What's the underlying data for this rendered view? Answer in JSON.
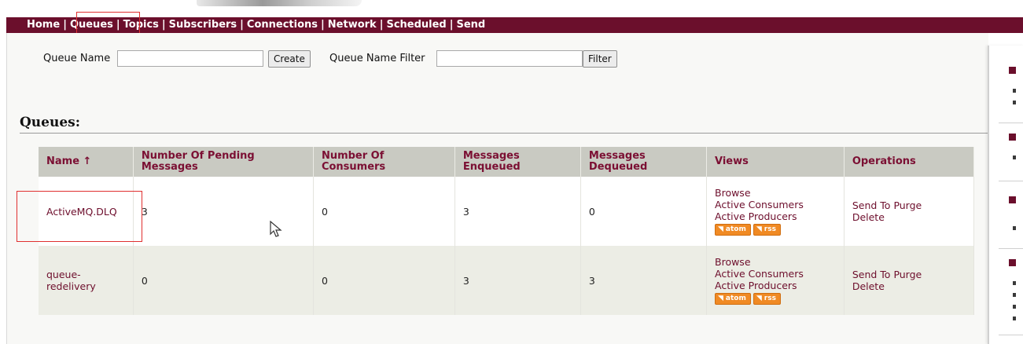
{
  "nav": {
    "items": [
      "Home",
      "Queues",
      "Topics",
      "Subscribers",
      "Connections",
      "Network",
      "Scheduled",
      "Send"
    ],
    "separator": "|"
  },
  "form": {
    "queue_name_label": "Queue Name",
    "queue_name_value": "",
    "create_label": "Create",
    "filter_label": "Queue Name Filter",
    "filter_value": "",
    "filter_button": "Filter"
  },
  "section_title": "Queues:",
  "table": {
    "headers": [
      "Name ↑",
      "Number Of Pending Messages",
      "Number Of Consumers",
      "Messages Enqueued",
      "Messages Dequeued",
      "Views",
      "Operations"
    ],
    "rows": [
      {
        "name": "ActiveMQ.DLQ",
        "pending": "3",
        "consumers": "0",
        "enqueued": "3",
        "dequeued": "0",
        "views": [
          "Browse",
          "Active Consumers",
          "Active Producers"
        ],
        "feeds": [
          "atom",
          "rss"
        ],
        "operations": [
          "Send To",
          "Purge",
          "Delete"
        ]
      },
      {
        "name": "queue-redelivery",
        "pending": "0",
        "consumers": "0",
        "enqueued": "3",
        "dequeued": "3",
        "views": [
          "Browse",
          "Active Consumers",
          "Active Producers"
        ],
        "feeds": [
          "atom",
          "rss"
        ],
        "operations": [
          "Send To",
          "Purge",
          "Delete"
        ]
      }
    ]
  },
  "colors": {
    "nav_bg": "#6b0f2c",
    "header_bg": "#c9cac2",
    "link": "#6d0e2c",
    "feed": "#f08a24",
    "highlight": "#e03030"
  },
  "icons": {
    "feed": "rss-feed-icon",
    "cursor": "mouse-pointer-icon"
  }
}
